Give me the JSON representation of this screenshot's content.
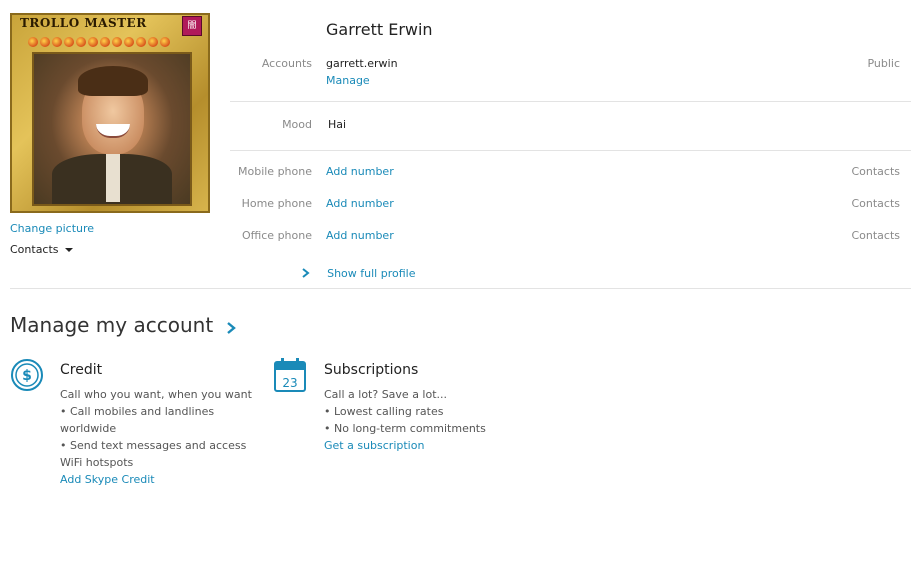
{
  "avatar": {
    "card_title": "TROLLO MASTER",
    "card_badge": "闇"
  },
  "left_links": {
    "change_picture": "Change picture",
    "contacts_label": "Contacts"
  },
  "profile": {
    "name": "Garrett Erwin",
    "accounts_label": "Accounts",
    "account_value": "garrett.erwin",
    "manage_link": "Manage",
    "accounts_visibility": "Public",
    "mood_label": "Mood",
    "mood_value": "Hai",
    "phones": [
      {
        "label": "Mobile phone",
        "action": "Add number",
        "visibility": "Contacts"
      },
      {
        "label": "Home phone",
        "action": "Add number",
        "visibility": "Contacts"
      },
      {
        "label": "Office phone",
        "action": "Add number",
        "visibility": "Contacts"
      }
    ],
    "show_full_profile": "Show full profile"
  },
  "manage_account": {
    "title": "Manage my account",
    "credit": {
      "title": "Credit",
      "lines": [
        "Call who you want, when you want",
        "• Call mobiles and landlines",
        "worldwide",
        "• Send text messages and access",
        "WiFi hotspots"
      ],
      "link": "Add Skype Credit"
    },
    "subscriptions": {
      "title": "Subscriptions",
      "calendar_day": "23",
      "lines": [
        "Call a lot? Save a lot...",
        "• Lowest calling rates",
        "• No long-term commitments"
      ],
      "link": "Get a subscription"
    }
  },
  "colors": {
    "link": "#1a8ab8",
    "label": "#8a8a8a"
  }
}
